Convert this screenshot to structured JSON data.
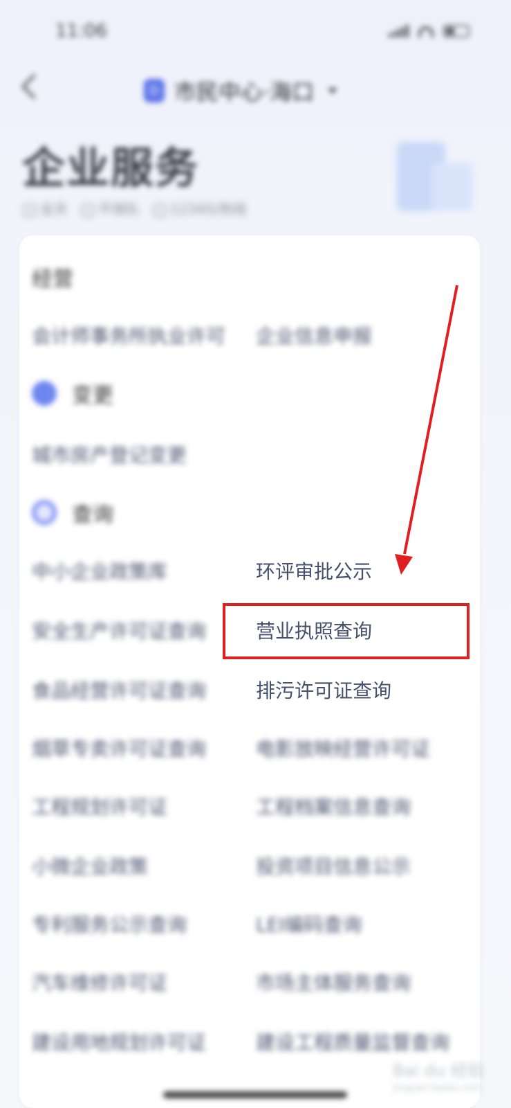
{
  "status_bar": {
    "time": "11:06"
  },
  "nav": {
    "title": "市民中心·海口",
    "location_icon_glyph": "D"
  },
  "hero": {
    "title": "企业服务",
    "meta": [
      "全天",
      "不排队",
      "12345/热线"
    ]
  },
  "sections": [
    {
      "heading": "经营",
      "items": [
        {
          "label": "会计师事务所执业许可",
          "blurred": true,
          "col": "left"
        },
        {
          "label": "企业信息申报",
          "blurred": true,
          "col": "right"
        }
      ]
    },
    {
      "heading": "变更",
      "items": [
        {
          "label": "城市房产登记变更",
          "blurred": true,
          "col": "left"
        }
      ]
    },
    {
      "heading": "查询",
      "items": [
        {
          "label": "中小企业政策库",
          "blurred": true,
          "col": "left"
        },
        {
          "label": "环评审批公示",
          "blurred": false,
          "col": "right"
        },
        {
          "label": "安全生产许可证查询",
          "blurred": true,
          "col": "left"
        },
        {
          "label": "营业执照查询",
          "blurred": false,
          "col": "right",
          "highlighted": true
        },
        {
          "label": "食品经营许可证查询",
          "blurred": true,
          "col": "left"
        },
        {
          "label": "排污许可证查询",
          "blurred": false,
          "col": "right"
        },
        {
          "label": "烟草专卖许可证查询",
          "blurred": true,
          "col": "left"
        },
        {
          "label": "电影放映经营许可证",
          "blurred": true,
          "col": "right"
        },
        {
          "label": "工程规划许可证",
          "blurred": true,
          "col": "left"
        },
        {
          "label": "工程档案信息查询",
          "blurred": true,
          "col": "right"
        },
        {
          "label": "小微企业政策",
          "blurred": true,
          "col": "left"
        },
        {
          "label": "投资项目信息公示",
          "blurred": true,
          "col": "right"
        },
        {
          "label": "专利服务公示查询",
          "blurred": true,
          "col": "left"
        },
        {
          "label": "LEI编码查询",
          "blurred": true,
          "col": "right"
        },
        {
          "label": "汽车维修许可证",
          "blurred": true,
          "col": "left"
        },
        {
          "label": "市场主体服务查询",
          "blurred": true,
          "col": "right"
        },
        {
          "label": "建设用地规划许可证",
          "blurred": true,
          "col": "left"
        },
        {
          "label": "建设工程质量监督查询",
          "blurred": true,
          "col": "right"
        }
      ]
    }
  ],
  "annotation": {
    "color": "#e02020"
  },
  "watermark": {
    "brand": "Bai du 经验",
    "url": "jingyan.baidu.com"
  }
}
